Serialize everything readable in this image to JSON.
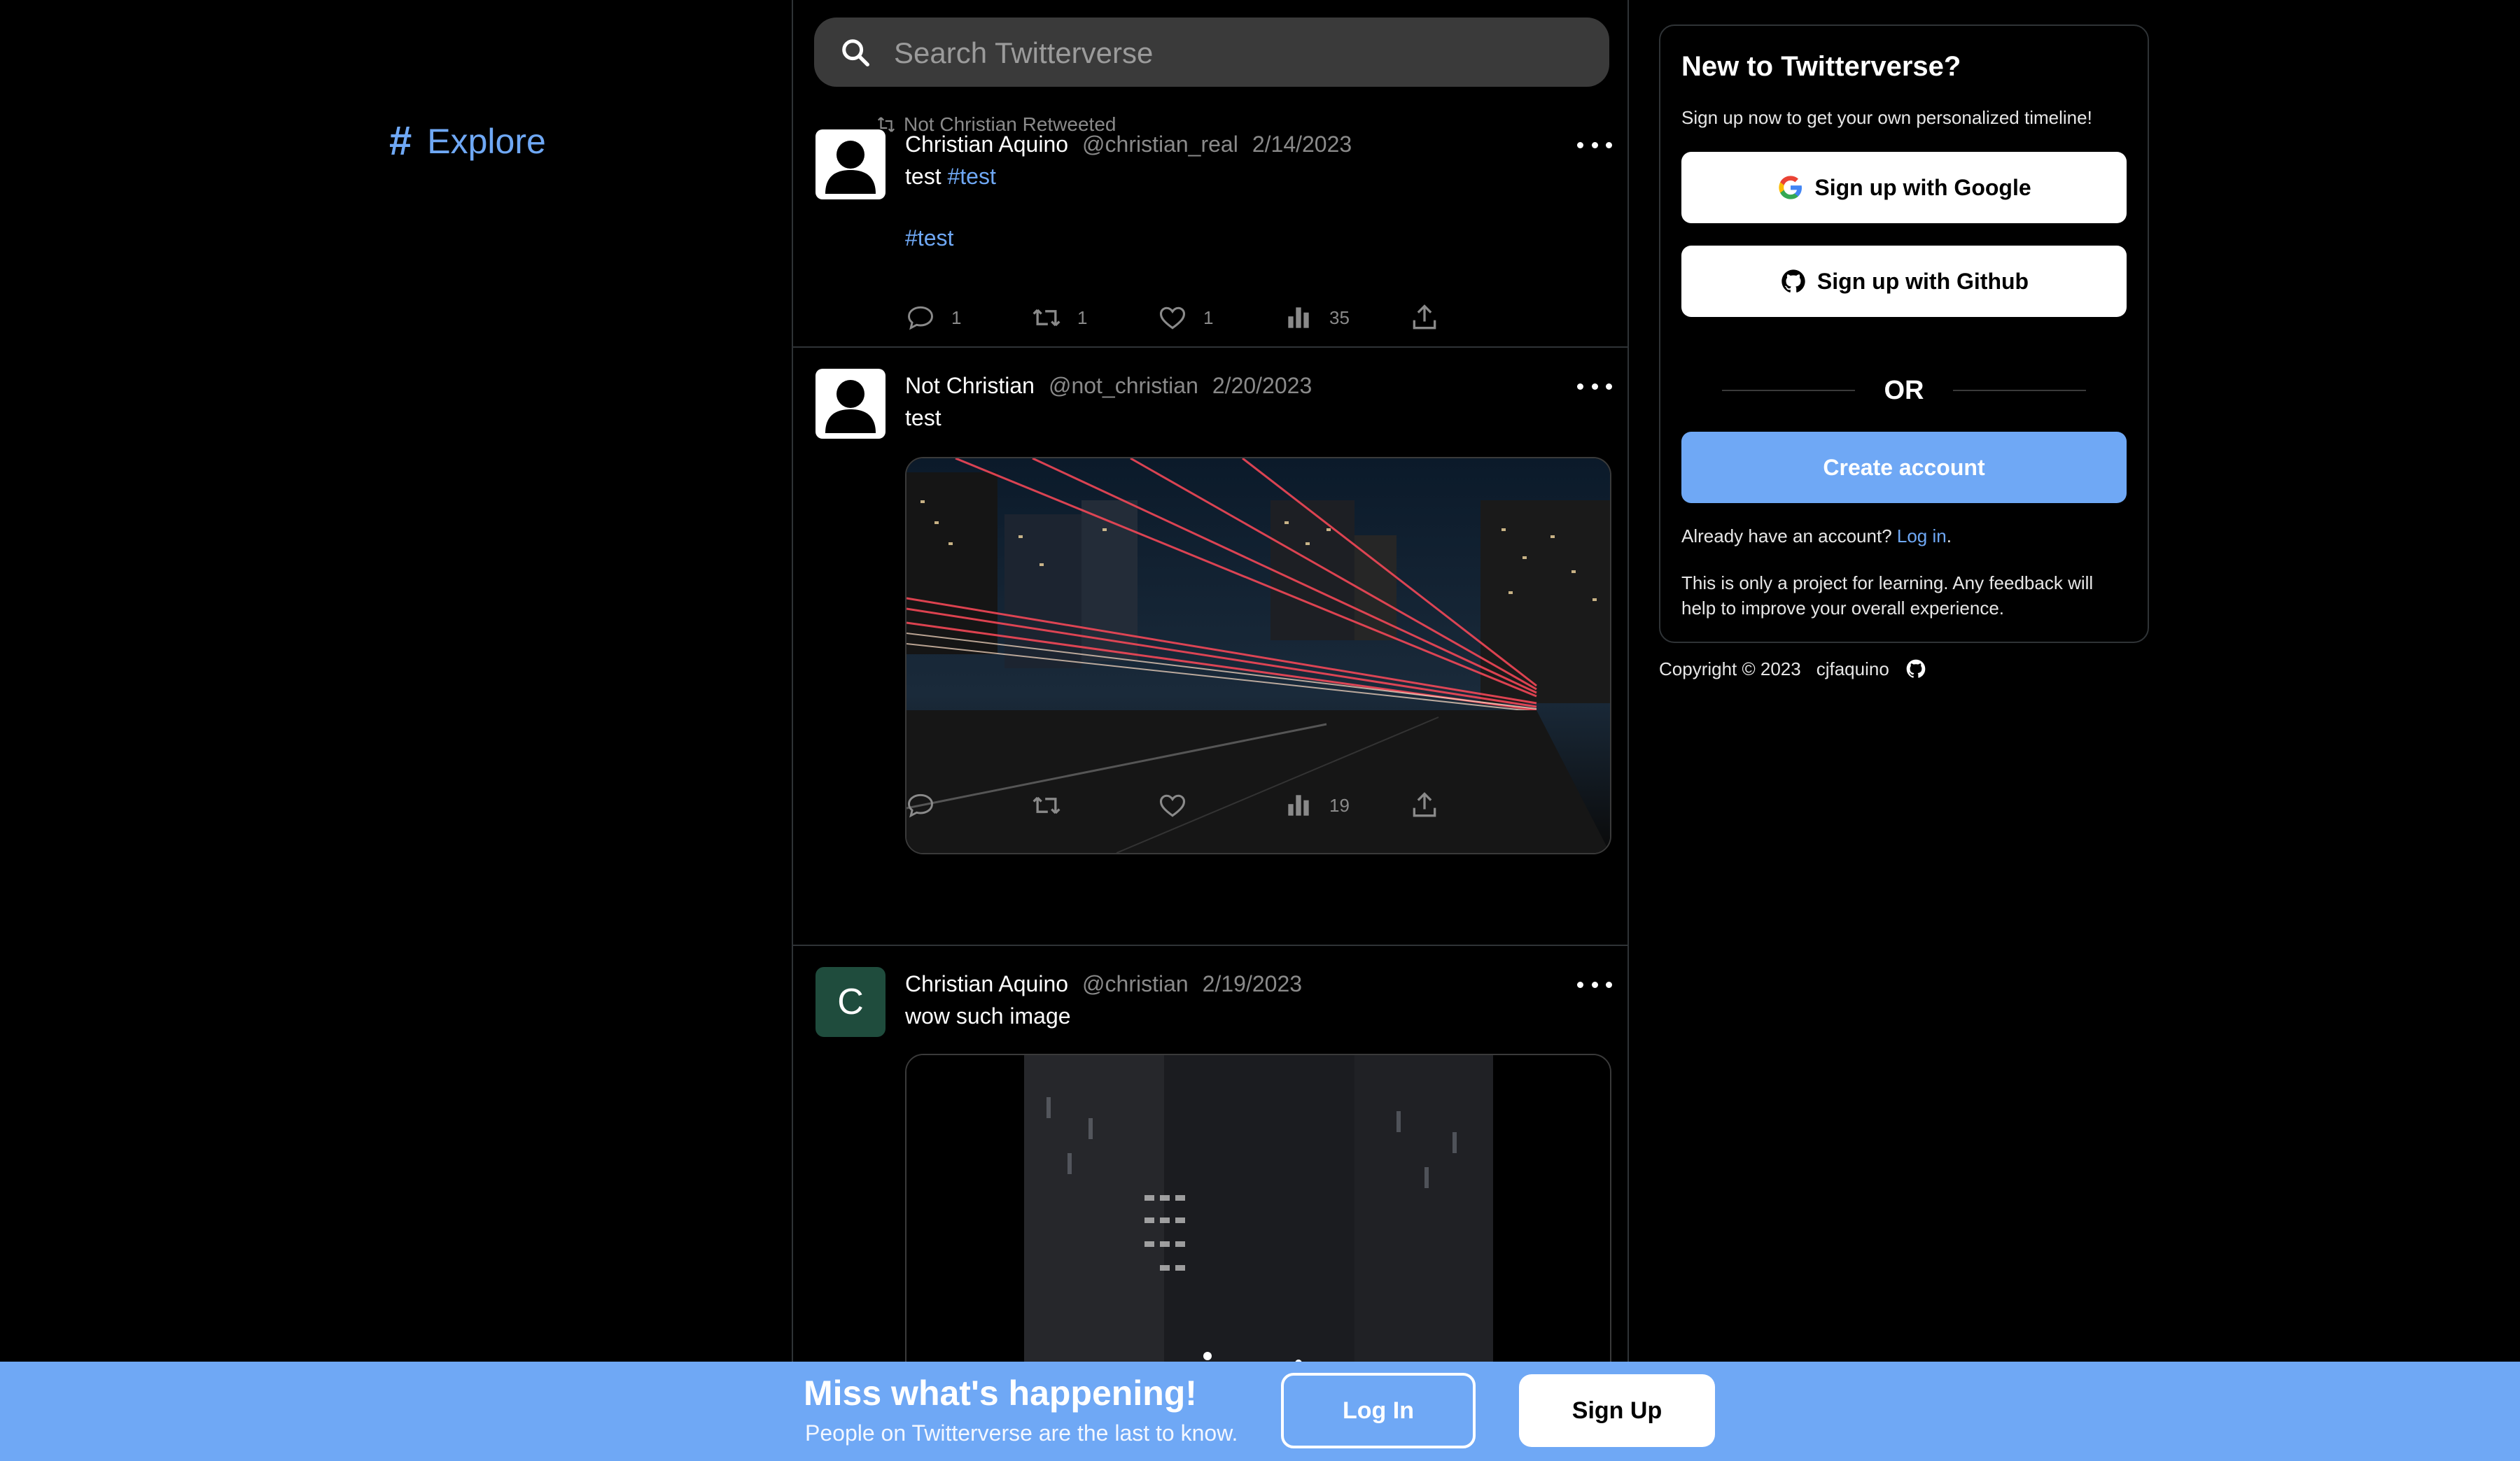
{
  "nav": {
    "explore_label": "Explore",
    "explore_icon": "hashtag-icon"
  },
  "search": {
    "placeholder": "Search Twitterverse"
  },
  "tweets": [
    {
      "retweeted_by": "Not Christian Retweeted",
      "name": "Christian Aquino",
      "handle": "@christian_real",
      "date": "2/14/2023",
      "text": "test",
      "inline_hashtag": "#test",
      "hashtag_line": "#test",
      "stats": {
        "replies": "1",
        "retweets": "1",
        "likes": "1",
        "views": "35"
      }
    },
    {
      "name": "Not Christian",
      "handle": "@not_christian",
      "date": "2/20/2023",
      "text": "test",
      "stats": {
        "replies": "",
        "retweets": "",
        "likes": "",
        "views": "19"
      }
    },
    {
      "avatar_letter": "C",
      "name": "Christian Aquino",
      "handle": "@christian",
      "date": "2/19/2023",
      "text": "wow such image"
    }
  ],
  "signup_panel": {
    "title": "New to Twitterverse?",
    "subtitle": "Sign up now to get your own personalized timeline!",
    "google_label": "Sign up with Google",
    "github_label": "Sign up with Github",
    "or_label": "OR",
    "create_label": "Create account",
    "already_text": "Already have an account?",
    "login_link": "Log in",
    "already_suffix": ".",
    "learning_note": "This is only a project for learning. Any feedback will help to improve your overall experience."
  },
  "footer": {
    "copyright": "Copyright © 2023",
    "author": "cjfaquino"
  },
  "banner": {
    "title": "Miss what's happening!",
    "subtitle": "People on Twitterverse are the last to know.",
    "login_label": "Log In",
    "signup_label": "Sign Up"
  },
  "colors": {
    "accent": "#6fa8f5",
    "background": "#000000",
    "muted": "#8a8a8a",
    "avatar_green": "#1f4c3d"
  }
}
